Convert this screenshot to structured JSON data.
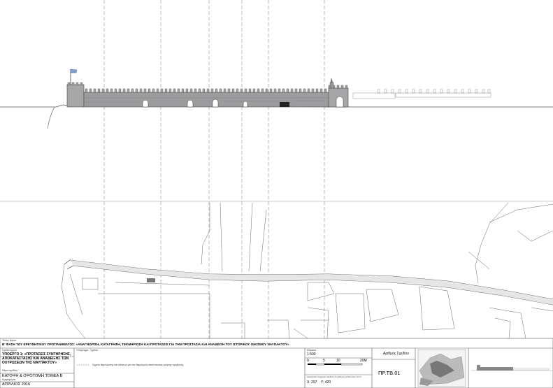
{
  "title_block": {
    "project_label": "Τίτλος έργου",
    "project_title": "Β' ΦΑΣΗ ΤΟΥ ΕΡΕΥΝΗΤΙΚΟΥ ΠΡΟΓΡΑΜΜΑΤΟΣ: «ΑΝΑΓΝΩΡΙΣΗ, ΚΑΤΑΓΡΑΦΗ, ΤΕΚΜΗΡΙΩΣΗ ΚΑΙ ΠΡΟΤΑΣΕΙΣ ΓΙΑ ΤΗΝ ΠΡΟΣΤΑΣΙΑ ΚΑΙ ΑΝΑΔΕΙΞΗ ΤΟΥ ΙΣΤΟΡΙΚΟΥ ΟΙΚΙΣΜΟΥ ΝΑΥΠΑΚΤΟΥ»",
    "subproject_label": "Σχέδιο έργου",
    "subproject_lines": [
      "ΥΠΟΕΡΓΟ 1: «ΠΡΟΤΑΣΕΙΣ ΣΥΝΤΗΡΗΣΗΣ,",
      "ΑΠΟΚΑΤΑΣΤΑΣΗΣ ΚΑΙ ΑΝΑΔΕΙΞΗΣ ΤΩΝ",
      "ΟΧΥΡΩΣΕΩΝ ΤΗΣ ΝΑΥΠΑΚΤΟΥ»"
    ],
    "drawing_label": "Θέμα σχεδίου",
    "drawing_title": "ΚΑΤΟΨΗ & ΟΨΟΤΟΜΗ ΤΟΜΕΑ Β",
    "date_label": "Ημερομηνία",
    "date": "ΑΠΡΙΛΙΟΣ 2016",
    "notes_label": "Υπόμνημα - Σχόλια",
    "notes_text": "Σημείο θεμελίωσης και κλίσεων για τον θεμελιωτή αποτύπωσης κρήσης προβολής",
    "scale_label": "Κλίμακα",
    "scale": "1:500",
    "scale_ticks": [
      "0",
      "5",
      "10",
      "20M"
    ],
    "coords_label": "Διαστάσεις πλαισίου σχεδίου σε χιλιοστά εκτύπωσης (mm)",
    "coord_x": "X: 297",
    "coord_y": "Y: 420",
    "sheet_label": "Αριθμός Σχεδίου",
    "sheet_number": "ΠΡ.ΤΒ.01"
  }
}
